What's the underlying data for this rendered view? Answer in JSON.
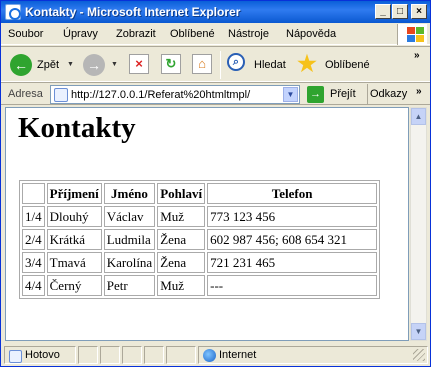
{
  "window": {
    "title": "Kontakty - Microsoft Internet Explorer"
  },
  "menu": {
    "items": [
      "Soubor",
      "Úpravy",
      "Zobrazit",
      "Oblíbené",
      "Nástroje",
      "Nápověda"
    ]
  },
  "toolbar": {
    "back_label": "Zpět",
    "search_label": "Hledat",
    "favorites_label": "Oblíbené"
  },
  "address": {
    "label": "Adresa",
    "url": "http://127.0.0.1/Referat%20htmltmpl/",
    "go_label": "Přejít",
    "links_label": "Odkazy"
  },
  "page": {
    "heading": "Kontakty",
    "table": {
      "headers": [
        "",
        "Příjmení",
        "Jméno",
        "Pohlaví",
        "Telefon"
      ],
      "rows": [
        [
          "1/4",
          "Dlouhý",
          "Václav",
          "Muž",
          "773 123 456"
        ],
        [
          "2/4",
          "Krátká",
          "Ludmila",
          "Žena",
          "602 987 456; 608 654 321"
        ],
        [
          "3/4",
          "Tmavá",
          "Karolína",
          "Žena",
          "721 231 465"
        ],
        [
          "4/4",
          "Černý",
          "Petr",
          "Muž",
          "---"
        ]
      ]
    }
  },
  "status": {
    "left": "Hotovo",
    "zone": "Internet"
  },
  "colors": {
    "titlebar": "#0a5fd8",
    "chrome": "#ece9d8",
    "go_button": "#2fa42f"
  }
}
